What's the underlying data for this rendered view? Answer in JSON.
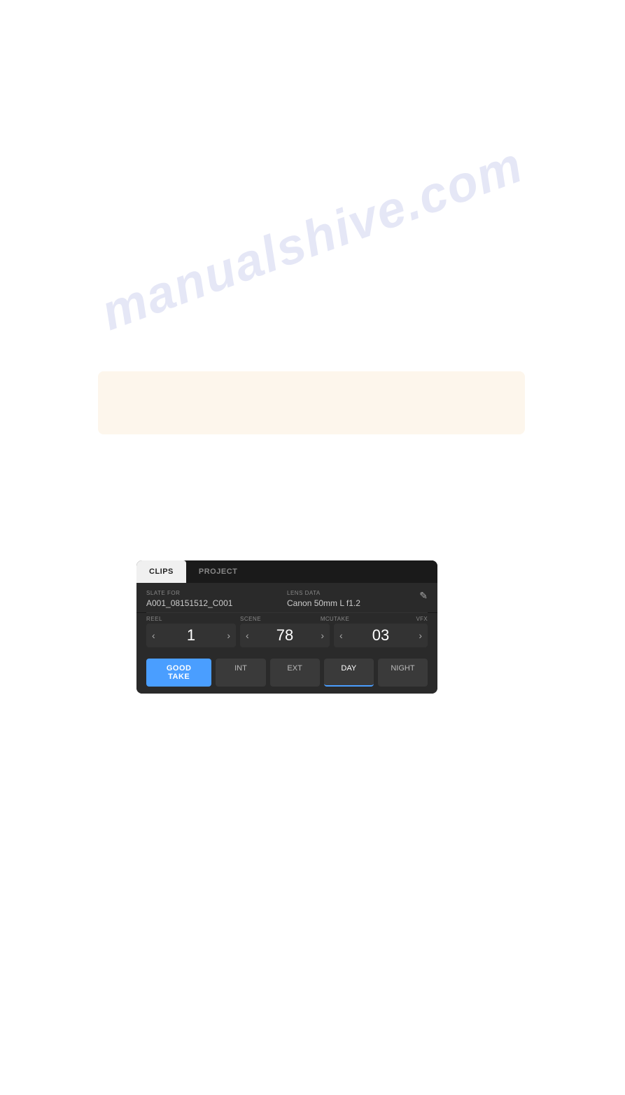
{
  "watermark": {
    "text": "manualshive.com"
  },
  "cream_banner": {
    "visible": true
  },
  "ui": {
    "tabs": [
      {
        "id": "clips",
        "label": "CLIPS",
        "active": true
      },
      {
        "id": "project",
        "label": "PROJECT",
        "active": false
      }
    ],
    "slate_label": "SLATE FOR",
    "slate_value": "A001_08151512_C001",
    "lens_label": "LENS DATA",
    "lens_value": "Canon 50mm L f1.2",
    "edit_icon": "✎",
    "reel_label": "REEL",
    "reel_value": "1",
    "scene_label": "SCENE",
    "scene_badge": "MCU",
    "scene_value": "78",
    "take_label": "TAKE",
    "take_badge": "VFX",
    "take_value": "03",
    "good_take_label": "GOOD TAKE",
    "btn_int": "INT",
    "btn_ext": "EXT",
    "btn_day": "DAY",
    "btn_night": "NIGHT",
    "chevron_left": "‹",
    "chevron_right": "›"
  }
}
